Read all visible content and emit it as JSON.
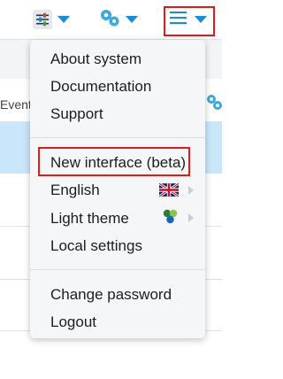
{
  "toolbar": {
    "settings_icon": "sliders-icon",
    "gears_icon": "gears-icon",
    "menu_icon": "hamburger-menu-icon",
    "caret_icon": "caret-down-icon",
    "accent_color": "#1a8bd6",
    "highlight_color": "#e11b1b"
  },
  "background": {
    "column_label": "Event"
  },
  "menu": {
    "group1": [
      "About system",
      "Documentation",
      "Support"
    ],
    "new_interface": "New interface (beta)",
    "language": "English",
    "language_flag": "uk-flag-icon",
    "theme": "Light theme",
    "theme_icon": "color-dots-icon",
    "local_settings": "Local settings",
    "group3": [
      "Change password",
      "Logout"
    ]
  }
}
